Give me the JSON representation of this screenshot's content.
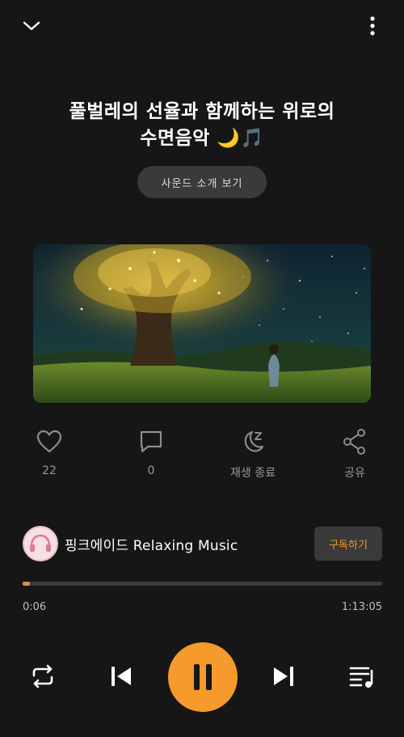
{
  "header": {
    "collapse_icon": "chevron-down-icon",
    "more_icon": "more-vertical-icon"
  },
  "track": {
    "title_line1": "풀벌레의 선율과 함께하는 위로의",
    "title_line2": "수면음악 🌙🎵",
    "sound_intro_label": "사운드 소개 보기"
  },
  "actions": {
    "like": {
      "icon": "heart-icon",
      "label": "22"
    },
    "comment": {
      "icon": "comment-icon",
      "label": "0"
    },
    "sleep_timer": {
      "icon": "moon-zzz-icon",
      "label": "재생 종료"
    },
    "share": {
      "icon": "share-icon",
      "label": "공유"
    }
  },
  "channel": {
    "name": "핑크에이드 Relaxing Music",
    "subscribe_label": "구독하기"
  },
  "playback": {
    "current_time": "0:06",
    "total_time": "1:13:05",
    "progress_fraction": 0.0014,
    "state": "playing"
  },
  "controls": {
    "repeat_icon": "repeat-icon",
    "prev_icon": "skip-previous-icon",
    "pause_icon": "pause-icon",
    "next_icon": "skip-next-icon",
    "queue_icon": "playlist-icon"
  },
  "colors": {
    "background": "#161616",
    "accent": "#f59a2b",
    "button_bg": "#3a3a3a",
    "muted_text": "#9a9a9a"
  }
}
